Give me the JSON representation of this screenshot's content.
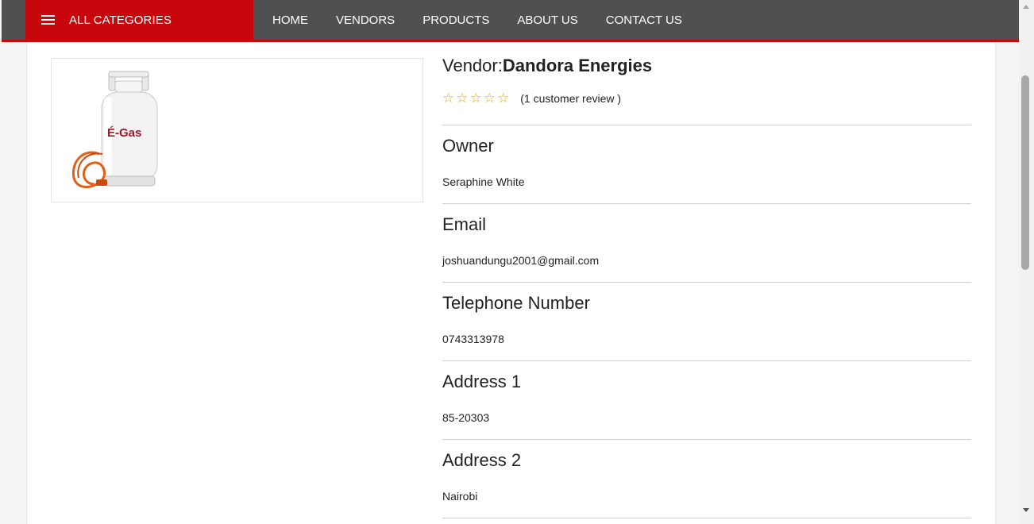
{
  "navbar": {
    "categories_label": "ALL CATEGORIES",
    "links": [
      "HOME",
      "VENDORS",
      "PRODUCTS",
      "ABOUT US",
      "CONTACT US"
    ]
  },
  "product_image": {
    "brand_text": "É-Gas"
  },
  "vendor": {
    "prefix": "Vendor:",
    "name": "Dandora Energies",
    "rating_stars": 0,
    "max_stars": 5,
    "review_text": "(1 customer review )"
  },
  "fields": [
    {
      "label": "Owner",
      "value": "Seraphine White"
    },
    {
      "label": "Email",
      "value": "joshuandungu2001@gmail.com"
    },
    {
      "label": "Telephone Number",
      "value": "0743313978"
    },
    {
      "label": "Address 1",
      "value": "85-20303"
    },
    {
      "label": "Address 2",
      "value": "Nairobi"
    }
  ],
  "colors": {
    "accent": "#c8070c",
    "navbar": "#505050",
    "star": "#f0a800"
  }
}
